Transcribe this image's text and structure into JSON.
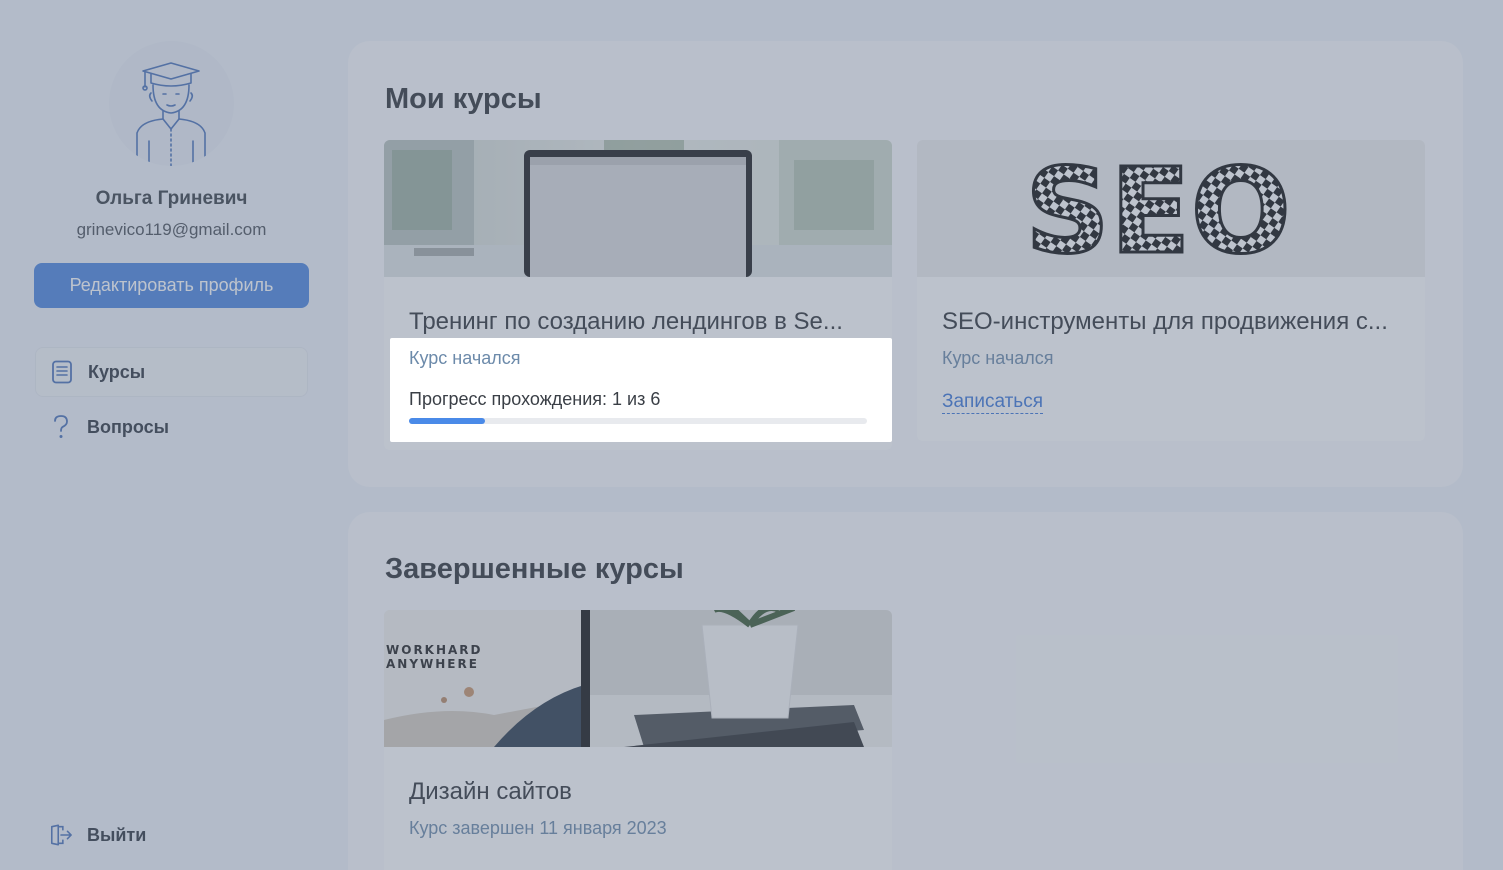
{
  "profile": {
    "name": "Ольга Гриневич",
    "email": "grinevico119@gmail.com",
    "edit_label": "Редактировать профиль",
    "avatar_icon": "graduate-avatar-icon"
  },
  "nav": {
    "courses_label": "Курсы",
    "questions_label": "Вопросы",
    "logout_label": "Выйти"
  },
  "my_courses": {
    "title": "Мои курсы",
    "cards": [
      {
        "title": "Тренинг по созданию лендингов в Se...",
        "status": "Курс начался",
        "progress_label": "Прогресс прохождения: 1 из 6",
        "progress_done": 1,
        "progress_total": 6
      },
      {
        "title": "SEO-инструменты для продвижения с...",
        "status": "Курс начался",
        "enroll_label": "Записаться"
      }
    ]
  },
  "done_courses": {
    "title": "Завершенные курсы",
    "cards": [
      {
        "title": "Дизайн сайтов",
        "status": "Курс завершен 11 января 2023"
      }
    ]
  },
  "image_text": {
    "seo": "SEO",
    "workhard": "WORKHARD",
    "anywhere": "ANYWHERE"
  },
  "colors": {
    "accent": "#4c86de",
    "progress": "#4a8ae8",
    "link": "#3d78d8",
    "overlay": "rgba(98,112,135,0.42)"
  }
}
